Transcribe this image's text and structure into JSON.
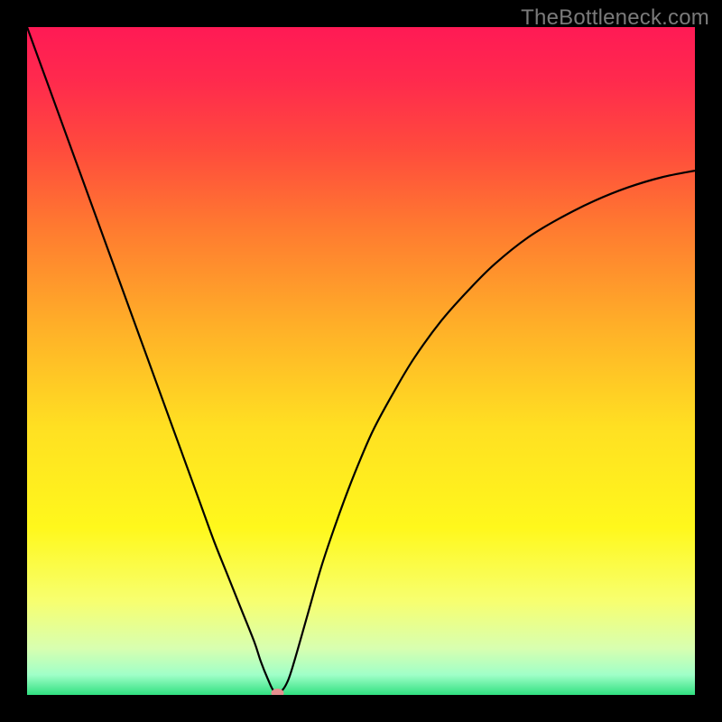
{
  "watermark": "TheBottleneck.com",
  "chart_data": {
    "type": "line",
    "title": "",
    "xlabel": "",
    "ylabel": "",
    "xlim": [
      0,
      100
    ],
    "ylim": [
      0,
      100
    ],
    "background_gradient": {
      "stops": [
        {
          "offset": 0.0,
          "color": "#ff1a55"
        },
        {
          "offset": 0.08,
          "color": "#ff2a4d"
        },
        {
          "offset": 0.18,
          "color": "#ff4a3d"
        },
        {
          "offset": 0.3,
          "color": "#ff7a30"
        },
        {
          "offset": 0.45,
          "color": "#ffb028"
        },
        {
          "offset": 0.6,
          "color": "#ffe022"
        },
        {
          "offset": 0.75,
          "color": "#fff81c"
        },
        {
          "offset": 0.86,
          "color": "#f7ff70"
        },
        {
          "offset": 0.93,
          "color": "#d8ffb0"
        },
        {
          "offset": 0.97,
          "color": "#a0ffc8"
        },
        {
          "offset": 1.0,
          "color": "#30e080"
        }
      ]
    },
    "series": [
      {
        "name": "bottleneck-curve",
        "color": "#000000",
        "width": 2.2,
        "x": [
          0,
          2,
          4,
          6,
          8,
          10,
          12,
          14,
          16,
          18,
          20,
          22,
          24,
          26,
          28,
          30,
          32,
          34,
          35,
          36,
          37,
          38,
          39,
          40,
          42,
          44,
          46,
          48,
          50,
          52,
          55,
          58,
          62,
          66,
          70,
          75,
          80,
          85,
          90,
          95,
          100
        ],
        "y": [
          100,
          94.5,
          89,
          83.5,
          78,
          72.5,
          67,
          61.5,
          56,
          50.5,
          45,
          39.5,
          34,
          28.5,
          23,
          18,
          13,
          8,
          5,
          2.5,
          0.5,
          0.5,
          2,
          5,
          12,
          19,
          25,
          30.5,
          35.5,
          40,
          45.5,
          50.5,
          56,
          60.5,
          64.5,
          68.5,
          71.5,
          74,
          76,
          77.5,
          78.5
        ]
      }
    ],
    "marker": {
      "name": "min-point",
      "x": 37.5,
      "y": 0,
      "rx": 7,
      "ry": 5,
      "color": "#e58f8f"
    }
  }
}
